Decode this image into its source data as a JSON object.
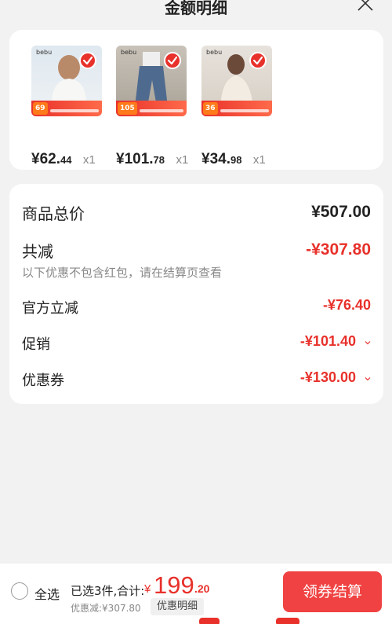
{
  "header": {
    "title": "金额明细"
  },
  "products": [
    {
      "brand": "bebu",
      "badge": "69",
      "price_big": "¥62.",
      "price_small": "44",
      "qty": "x1"
    },
    {
      "brand": "bebu",
      "badge": "105",
      "price_big": "¥101.",
      "price_small": "78",
      "qty": "x1"
    },
    {
      "brand": "bebu",
      "badge": "36",
      "price_big": "¥34.",
      "price_small": "98",
      "qty": "x1"
    }
  ],
  "summary": {
    "total_label": "商品总价",
    "total_value": "¥507.00",
    "reduce_label": "共减",
    "reduce_value": "-¥307.80",
    "reduce_note": "以下优惠不包含红包，请在结算页查看",
    "official_label": "官方立减",
    "official_value": "-¥76.40",
    "promo_label": "促销",
    "promo_value": "-¥101.40",
    "coupon_label": "优惠券",
    "coupon_value": "-¥130.00"
  },
  "bottom": {
    "select_all": "全选",
    "selected_text": "已选3件,合计:",
    "currency": "¥",
    "total_int": "199",
    "total_dec": ".20",
    "discount_text": "优惠减:¥307.80",
    "detail_button": "优惠明细",
    "checkout_button": "领券结算"
  },
  "colors": {
    "accent": "#e8312b",
    "checkout": "#f04242"
  }
}
